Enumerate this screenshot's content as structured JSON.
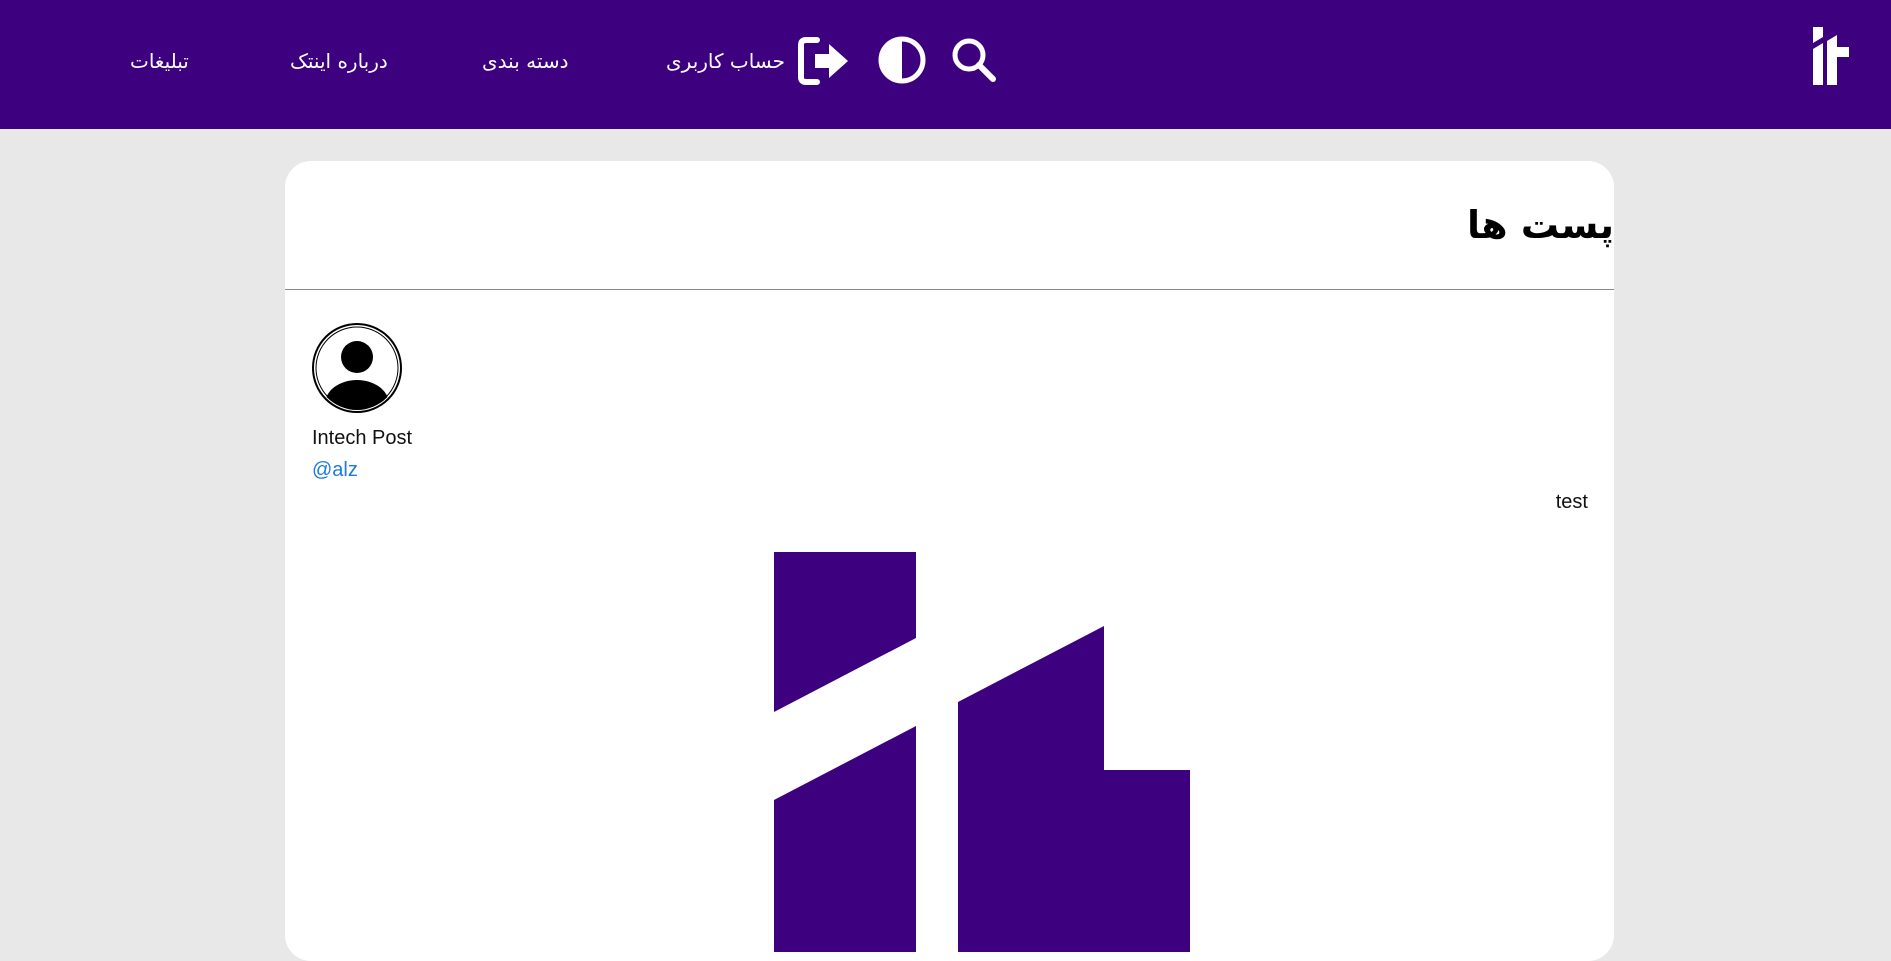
{
  "header": {
    "nav": {
      "ads": "تبلیغات",
      "about": "درباره اینتک",
      "categories": "دسته بندی",
      "account": "حساب کاربری"
    },
    "icons": {
      "logout": "logout-icon",
      "contrast": "contrast-toggle-icon",
      "search": "search-icon",
      "logo": "intech-logo"
    },
    "background_color": "#3d007f"
  },
  "main": {
    "title": "پست ها",
    "post": {
      "author_name": "Intech Post",
      "author_handle": "@alz",
      "text": "test",
      "avatar_icon": "user-avatar-icon",
      "image": "intech-logo-image"
    }
  },
  "colors": {
    "brand": "#3d007f",
    "link": "#1a7be0",
    "page_background": "#e8e8e8"
  }
}
